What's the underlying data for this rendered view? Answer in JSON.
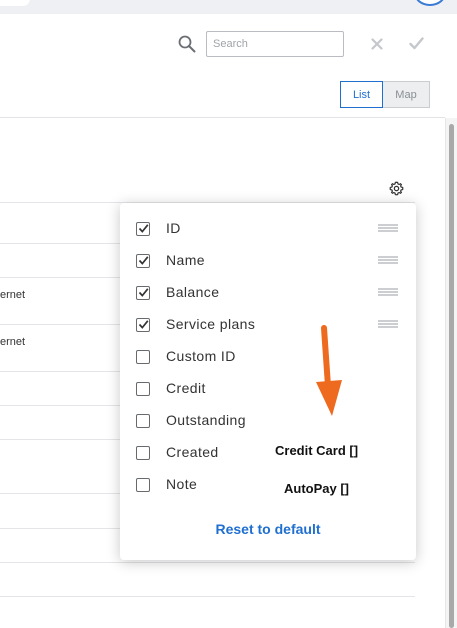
{
  "header": {
    "search": {
      "placeholder": "Search",
      "value": ""
    },
    "icons": {
      "search": "search-icon",
      "clear": "close-icon",
      "confirm": "check-icon"
    },
    "view_toggle": {
      "options": [
        "List",
        "Map"
      ],
      "selected": "List"
    }
  },
  "table": {
    "rows": [
      {
        "text": ""
      },
      {
        "text": ""
      },
      {
        "text": "ernet"
      },
      {
        "text": "ernet"
      },
      {
        "text": ""
      },
      {
        "text": ""
      },
      {
        "text": ""
      },
      {
        "text": ""
      },
      {
        "text": ""
      },
      {
        "text": ""
      }
    ]
  },
  "column_settings": {
    "gear_icon": "gear-icon",
    "items": [
      {
        "label": "ID",
        "checked": true,
        "draggable": true
      },
      {
        "label": "Name",
        "checked": true,
        "draggable": true
      },
      {
        "label": "Balance",
        "checked": true,
        "draggable": true
      },
      {
        "label": "Service plans",
        "checked": true,
        "draggable": true
      },
      {
        "label": "Custom ID",
        "checked": false,
        "draggable": false
      },
      {
        "label": "Credit",
        "checked": false,
        "draggable": false
      },
      {
        "label": "Outstanding",
        "checked": false,
        "draggable": false
      },
      {
        "label": "Created",
        "checked": false,
        "draggable": false
      },
      {
        "label": "Note",
        "checked": false,
        "draggable": false
      }
    ],
    "reset_label": "Reset to default"
  },
  "annotations": {
    "credit_card": "Credit Card []",
    "autopay": "AutoPay []",
    "arrow_color": "#ee6a1f"
  },
  "colors": {
    "accent": "#1f6fd1",
    "arrow": "#ee6a1f"
  }
}
